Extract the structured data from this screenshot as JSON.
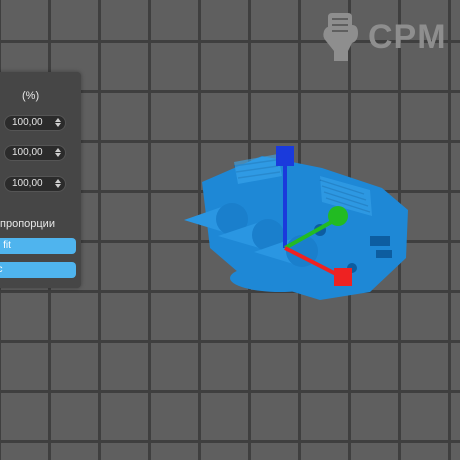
{
  "brand": {
    "logo_text": "CPM"
  },
  "scale_panel": {
    "unit_label": "(%)",
    "fields": [
      {
        "value": "100,00"
      },
      {
        "value": "100,00"
      },
      {
        "value": "100,00"
      }
    ],
    "proportions_label": "пропорции",
    "buttons": [
      {
        "label": "to fit"
      },
      {
        "label": "ос"
      }
    ]
  },
  "gizmo": {
    "colors": {
      "x": "#ee2222",
      "y": "#22bb22",
      "z": "#1a3adc"
    }
  },
  "colors": {
    "model": "#1e88d6",
    "button": "#4fb4ee",
    "panel": "#464646"
  }
}
